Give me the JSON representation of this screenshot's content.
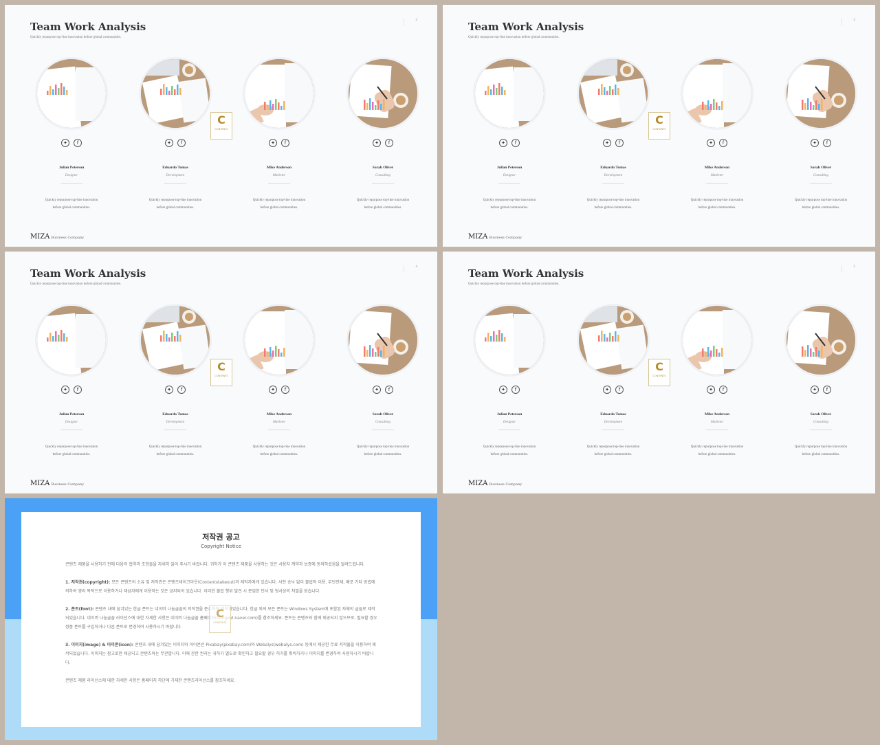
{
  "slide": {
    "title": "Team Work Analysis",
    "subtitle": "Quickly repurpose top-line innovation before global communities.",
    "brand": "MIZA",
    "brand_tagline": "Business Company",
    "badge_letter": "C",
    "badge_text": "CONTENTS"
  },
  "slide_pages": [
    "2",
    "3",
    "4",
    "5"
  ],
  "members": [
    {
      "name": "Julian Peterson",
      "role": "Designer",
      "desc_line1": "Quickly repurpose top-line innovation",
      "desc_line2": "before global communities."
    },
    {
      "name": "Eduardo Tomas",
      "role": "Development",
      "desc_line1": "Quickly repurpose top-line innovation",
      "desc_line2": "before global communities."
    },
    {
      "name": "Mike Anderson",
      "role": "Marketer",
      "desc_line1": "Quickly repurpose top-line innovation",
      "desc_line2": "before global communities."
    },
    {
      "name": "Sarah Oliver",
      "role": "Consulting",
      "desc_line1": "Quickly repurpose top-line innovation",
      "desc_line2": "before global communities."
    }
  ],
  "social_icons": [
    "twitter-icon",
    "facebook-icon"
  ],
  "colors": {
    "background": "#c2b6aa",
    "slide": "#f9fafc",
    "notice_top": "#4ba1f5",
    "notice_bottom": "#aedcf8",
    "badge_gold": "#b58e2a"
  },
  "notice": {
    "title": "저작권 공고",
    "subtitle": "Copyright Notice",
    "intro": "콘텐츠 제품을 사용하기 전에 다음의 협약과 조항들을 자세히 읽어 주시기 바랍니다. 귀하가 이 콘텐츠 제품을 사용하는 것은 사용자 계약과 보증에 동의하셨음을 알려드립니다.",
    "s1_head": "1. 저작권(copyright):",
    "s1_text": "모든 콘텐츠의 소유 및 저작권은 콘텐츠테이크아웃(Contentstakeout)과 제작자에게 있습니다. 사전 승낙 없이 불법적 이용, 무단전재, 배포 기타 방법에 의하여 영리 목적으로 이용하거나 제삼자에게 이용하는 것은 금지되어 있습니다. 이러한 불법 행위 발견 시 준엄한 민사 및 형사상의 처벌을 받습니다.",
    "s2_head": "2. 폰트(font):",
    "s2_text": "콘텐츠 내에 담겨있는 한글 폰트는 네이버 나눔글꼴의 저작권을 준수하여 제작되었습니다. 한글 외의 모든 폰트는 Windows System에 포함된 자체의 글꼴로 제작되었습니다. 네이버 나눔글꼴 라이선스에 대한 자세한 사항은 네이버 나눔글꼴 홈페이지(hangeul.naver.com)를 참조하세요. 폰트는 콘텐츠와 함께 제공되지 않으므로, 필요할 경우 정품 폰트를 구입하거나 다른 폰트로 변경하여 사용하시기 바랍니다.",
    "s3_head": "3. 이미지(image) & 아이콘(icon):",
    "s3_text": "콘텐츠 내에 담겨있는 이미지와 아이콘은 Pixabay(pixabay.com)와 Webalys(webalys.com) 등에서 제공한 무료 저작물을 이용하여 제작되었습니다. 이미지는 참고로만 제공되고 콘텐츠와는 무관합니다. 이에 관한 권리는 귀하가 별도로 확인하고 필요할 경우 허가를 취득하거나 이미지를 변경하여 사용하시기 바랍니다.",
    "footer": "콘텐츠 제품 라이선스에 대한 자세한 사항은 홈페이지 하단에 기재한 콘텐츠라이선스를 참조하세요."
  }
}
